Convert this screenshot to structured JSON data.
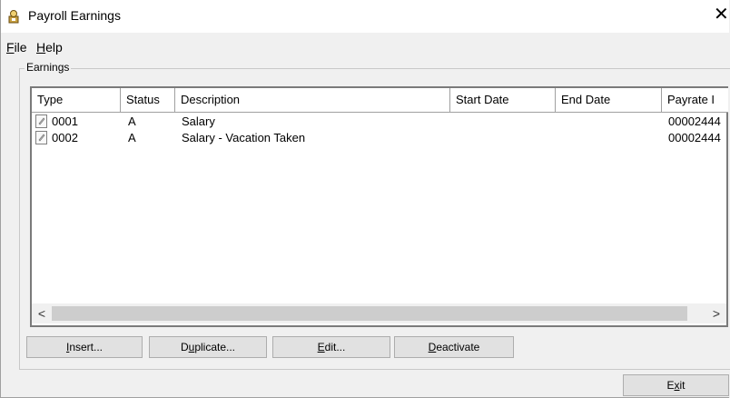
{
  "window": {
    "title": "Payroll Earnings",
    "close_glyph": "✕"
  },
  "menu": {
    "file": {
      "accel": "F",
      "rest": "ile"
    },
    "help": {
      "accel": "H",
      "rest": "elp"
    }
  },
  "group": {
    "label": "Earnings"
  },
  "list": {
    "columns": [
      "Type",
      "Status",
      "Description",
      "Start Date",
      "End Date",
      "Payrate I"
    ],
    "rows": [
      {
        "type": "0001",
        "status": "A",
        "description": "Salary",
        "start": "",
        "end": "",
        "payrate": "00002444"
      },
      {
        "type": "0002",
        "status": "A",
        "description": "Salary - Vacation Taken",
        "start": "",
        "end": "",
        "payrate": "00002444"
      }
    ],
    "scroll_left": "<",
    "scroll_right": ">"
  },
  "buttons": {
    "insert": {
      "accel": "I",
      "rest": "nsert..."
    },
    "duplicate": {
      "pre": "D",
      "accel": "u",
      "rest": "plicate..."
    },
    "edit": {
      "accel": "E",
      "rest": "dit..."
    },
    "deactivate": {
      "accel": "D",
      "rest": "eactivate"
    },
    "exit": {
      "pre": "E",
      "accel": "x",
      "rest": "it"
    }
  }
}
